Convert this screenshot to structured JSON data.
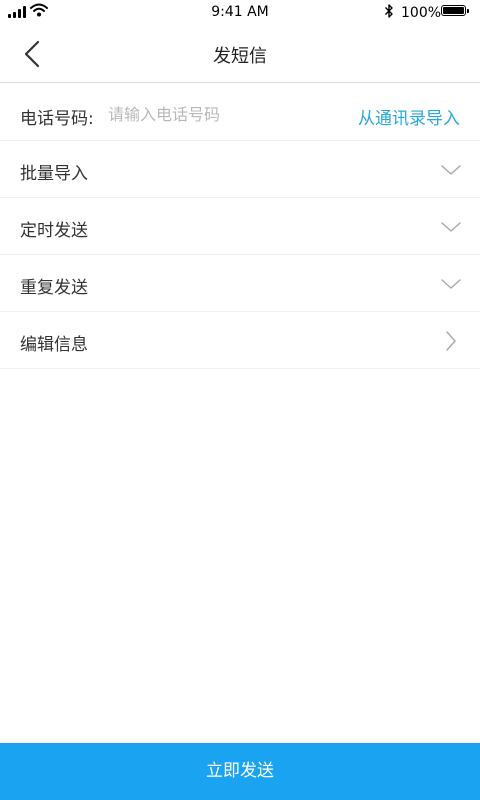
{
  "status_bar": {
    "time": "9:41 AM",
    "battery_percent": "100%",
    "icons": [
      "signal-icon",
      "wifi-icon",
      "bluetooth-icon",
      "battery-icon"
    ]
  },
  "nav": {
    "title": "发短信",
    "back_icon": "back-chevron-icon"
  },
  "phone": {
    "label": "电话号码:",
    "placeholder": "请输入电话号码",
    "value": "",
    "import_label": "从通讯录导入"
  },
  "rows": [
    {
      "label": "批量导入",
      "icon": "chevron-down-icon"
    },
    {
      "label": "定时发送",
      "icon": "chevron-down-icon"
    },
    {
      "label": "重复发送",
      "icon": "chevron-down-icon"
    },
    {
      "label": "编辑信息",
      "icon": "chevron-right-icon"
    }
  ],
  "send_button": {
    "label": "立即发送"
  },
  "colors": {
    "accent": "#1aa3f0",
    "link": "#2aa8d8",
    "divider": "#f0f0f0",
    "placeholder": "#b8b8b8"
  }
}
